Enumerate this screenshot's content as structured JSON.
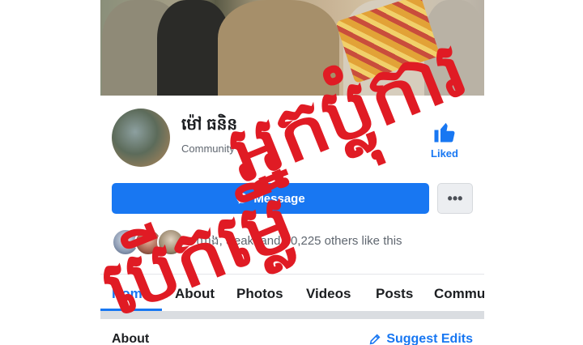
{
  "profile": {
    "name": "ម៉ៅ ធនិន",
    "category": "Community",
    "liked_label": "Liked"
  },
  "actions": {
    "message_label": "Message",
    "more_label": "•••"
  },
  "social": {
    "likes_text": "ឃាង, Seak, and 60,225 others like this"
  },
  "tabs": [
    {
      "label": "Home",
      "active": true
    },
    {
      "label": "About",
      "active": false
    },
    {
      "label": "Photos",
      "active": false
    },
    {
      "label": "Videos",
      "active": false
    },
    {
      "label": "Posts",
      "active": false
    },
    {
      "label": "Community",
      "active": false
    }
  ],
  "about": {
    "heading": "About",
    "suggest_edits": "Suggest Edits"
  },
  "watermark": {
    "line1": "អ្នកប្លុំការ",
    "line2": "បើកម្លើ"
  },
  "colors": {
    "accent": "#1877f2",
    "watermark": "#e01b24"
  },
  "icons": [
    "thumbs-up-icon",
    "messenger-icon",
    "more-icon",
    "pencil-icon"
  ]
}
